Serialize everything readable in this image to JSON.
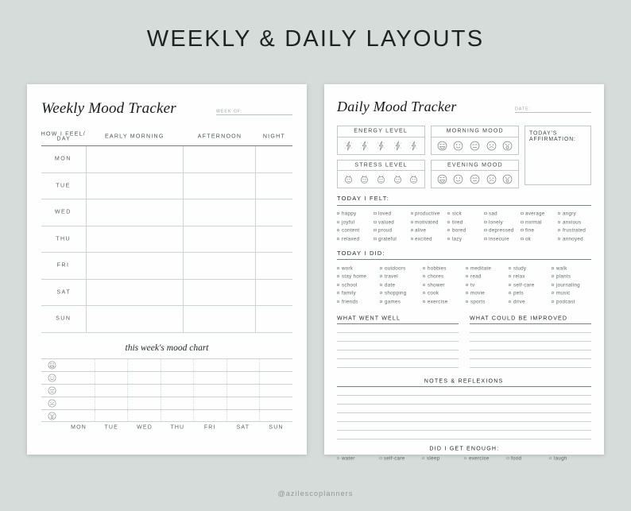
{
  "page": {
    "title": "WEEKLY & DAILY LAYOUTS",
    "footer_handle": "@azilescoplanners",
    "background_color": "#d5dcda",
    "sheet_color": "#fefefe"
  },
  "weekly": {
    "title": "Weekly Mood Tracker",
    "week_of_label": "WEEK OF:",
    "columns": [
      "HOW I FEEL/ DAY",
      "EARLY MORNING",
      "AFTERNOON",
      "NIGHT"
    ],
    "first_column_line1": "HOW I FEEL/",
    "first_column_line2": "DAY",
    "days": [
      "MON",
      "TUE",
      "WED",
      "THU",
      "FRI",
      "SAT",
      "SUN"
    ],
    "mood_chart": {
      "title": "this week's mood chart",
      "moods": [
        "grin-face",
        "smile-face",
        "neutral-face",
        "sad-face",
        "shocked-face"
      ],
      "days": [
        "MON",
        "TUE",
        "WED",
        "THU",
        "FRI",
        "SAT",
        "SUN"
      ]
    }
  },
  "daily": {
    "title": "Daily Mood Tracker",
    "date_label": "DATE:",
    "energy_level": {
      "label": "ENERGY LEVEL",
      "icon": "lightning-bolt-icon",
      "count": 5
    },
    "stress_level": {
      "label": "STRESS LEVEL",
      "icon": "stressed-face-icon",
      "count": 5
    },
    "morning_mood": {
      "label": "MORNING MOOD",
      "count": 5
    },
    "evening_mood": {
      "label": "EVENING MOOD",
      "count": 5
    },
    "affirmation": {
      "label": "TODAY'S AFFIRMATION:"
    },
    "felt": {
      "heading": "TODAY I FELT:",
      "items": [
        "happy",
        "loved",
        "productive",
        "sick",
        "sad",
        "average",
        "angry",
        "joyful",
        "valued",
        "motivated",
        "tired",
        "lonely",
        "normal",
        "anxious",
        "content",
        "proud",
        "alive",
        "bored",
        "depressed",
        "fine",
        "frustrated",
        "relaxed",
        "grateful",
        "excited",
        "lazy",
        "insecure",
        "ok",
        "annoyed"
      ]
    },
    "did": {
      "heading": "TODAY I DID:",
      "items": [
        "work",
        "outdoors",
        "hobbies",
        "meditate",
        "study",
        "walk",
        "stay home",
        "travel",
        "chores",
        "read",
        "relax",
        "plants",
        "school",
        "date",
        "shower",
        "tv",
        "self-care",
        "journaling",
        "family",
        "shopping",
        "cook",
        "movie",
        "pets",
        "music",
        "friends",
        "games",
        "exercise",
        "sports",
        "drive",
        "podcast"
      ]
    },
    "went_well": {
      "heading": "WHAT WENT WELL",
      "lines": 5
    },
    "improved": {
      "heading": "WHAT COULD BE IMPROVED",
      "lines": 5
    },
    "notes": {
      "heading": "NOTES & REFLEXIONS",
      "lines": 6
    },
    "enough": {
      "heading": "DID I GET ENOUGH:",
      "items": [
        "water",
        "self-care",
        "sleep",
        "exercise",
        "food",
        "laugh"
      ]
    }
  }
}
